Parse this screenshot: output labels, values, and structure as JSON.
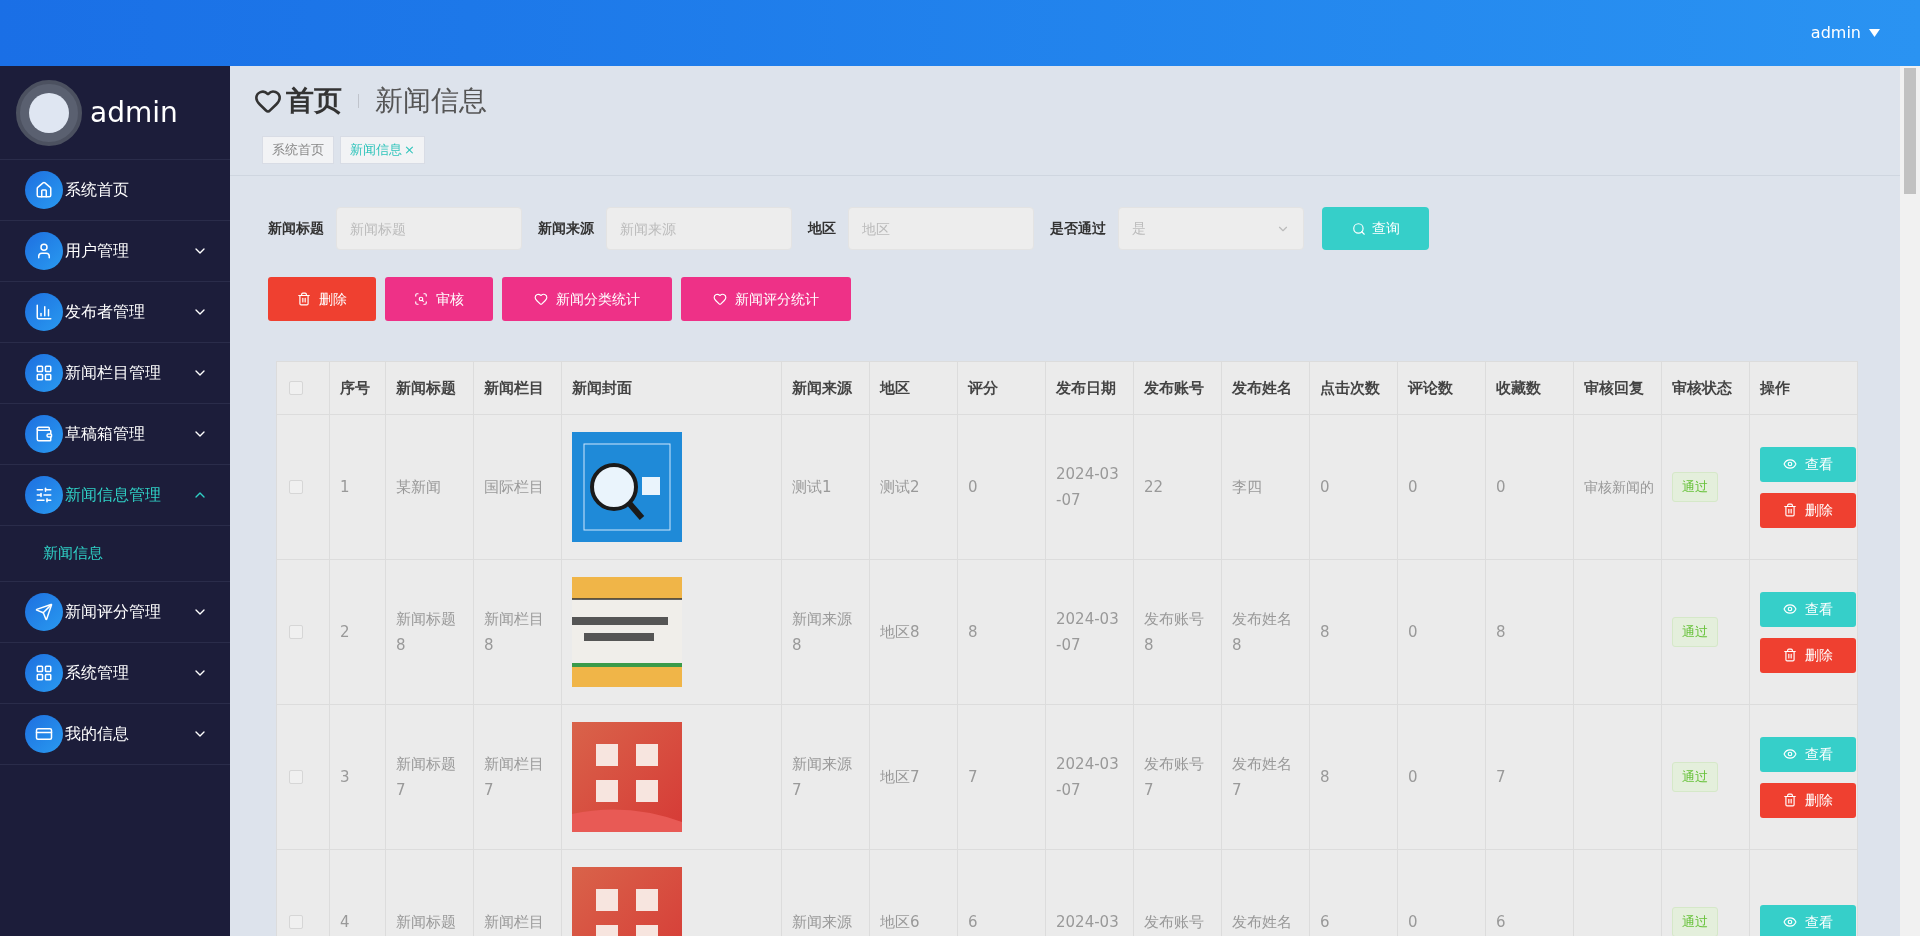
{
  "topbar": {
    "user": "admin"
  },
  "sidebar": {
    "user": "admin",
    "items": [
      {
        "label": "系统首页",
        "selected": false
      },
      {
        "label": "用户管理",
        "selected": false,
        "expanded": false
      },
      {
        "label": "发布者管理",
        "selected": false,
        "expanded": false
      },
      {
        "label": "新闻栏目管理",
        "selected": false,
        "expanded": false
      },
      {
        "label": "草稿箱管理",
        "selected": false,
        "expanded": false
      },
      {
        "label": "新闻信息管理",
        "selected": true,
        "expanded": true,
        "children": [
          {
            "label": "新闻信息",
            "selected": true
          }
        ]
      },
      {
        "label": "新闻评分管理",
        "selected": false,
        "expanded": false
      },
      {
        "label": "系统管理",
        "selected": false,
        "expanded": false
      },
      {
        "label": "我的信息",
        "selected": false,
        "expanded": false
      }
    ]
  },
  "breadcrumb": {
    "home": "首页",
    "current": "新闻信息"
  },
  "tabs": [
    {
      "label": "系统首页",
      "selected": false
    },
    {
      "label": "新闻信息",
      "selected": true,
      "close": "×"
    }
  ],
  "search": {
    "fields": [
      {
        "kind": "input",
        "label": "新闻标题",
        "placeholder": "新闻标题"
      },
      {
        "kind": "input",
        "label": "新闻来源",
        "placeholder": "新闻来源"
      },
      {
        "kind": "input",
        "label": "地区",
        "placeholder": "地区"
      },
      {
        "kind": "select",
        "label": "是否通过",
        "value": "是"
      }
    ],
    "button": "查询"
  },
  "actions": [
    {
      "label": "删除",
      "kind": "danger"
    },
    {
      "label": "审核",
      "kind": "accent"
    },
    {
      "label": "新闻分类统计",
      "kind": "accent"
    },
    {
      "label": "新闻评分统计",
      "kind": "accent"
    }
  ],
  "table": {
    "all_checked": false,
    "columns": [
      "序号",
      "新闻标题",
      "新闻栏目",
      "新闻封面",
      "新闻来源",
      "地区",
      "评分",
      "发布日期",
      "发布账号",
      "发布姓名",
      "点击次数",
      "评论数",
      "收藏数",
      "审核回复",
      "审核状态",
      "操作"
    ],
    "rows": [
      {
        "checked": false,
        "cells": [
          "1",
          "某新闻",
          "国际栏目",
          "",
          "测试1",
          "测试2",
          "0",
          "2024-03-07",
          "22",
          "李四",
          "0",
          "0",
          "0",
          "审核新闻的"
        ],
        "status": "通过",
        "buttons": [
          "查看",
          "删除"
        ]
      },
      {
        "checked": false,
        "cells": [
          "2",
          "新闻标题8",
          "新闻栏目8",
          "",
          "新闻来源8",
          "地区8",
          "8",
          "2024-03-07",
          "发布账号8",
          "发布姓名8",
          "8",
          "0",
          "8",
          ""
        ],
        "status": "通过",
        "buttons": [
          "查看",
          "删除"
        ]
      },
      {
        "checked": false,
        "cells": [
          "3",
          "新闻标题7",
          "新闻栏目7",
          "",
          "新闻来源7",
          "地区7",
          "7",
          "2024-03-07",
          "发布账号7",
          "发布姓名7",
          "8",
          "0",
          "7",
          ""
        ],
        "status": "通过",
        "buttons": [
          "查看",
          "删除"
        ]
      },
      {
        "checked": false,
        "cells": [
          "4",
          "新闻标题",
          "新闻栏目",
          "",
          "新闻来源",
          "地区6",
          "6",
          "2024-03",
          "发布账号",
          "发布姓名",
          "6",
          "0",
          "6",
          ""
        ],
        "status": "通过",
        "buttons": [
          "查看"
        ]
      }
    ]
  }
}
